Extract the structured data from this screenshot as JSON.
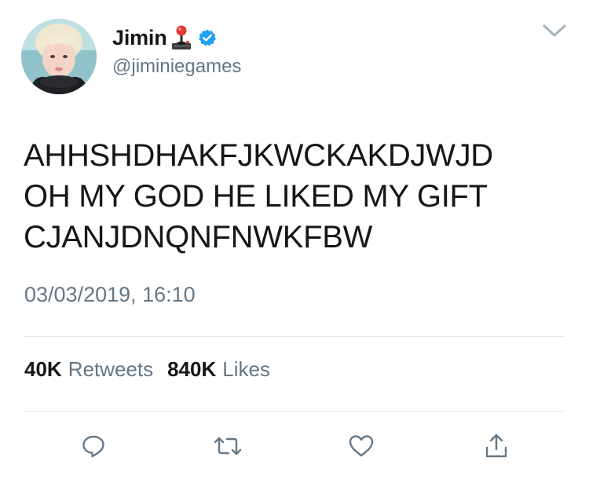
{
  "user": {
    "display_name": "Jimin",
    "handle": "@jiminiegames",
    "name_emoji": "joystick-icon",
    "verified": true
  },
  "tweet": {
    "lines": [
      "AHHSHDHAKFJKWCKAKDJWJD",
      "OH MY GOD HE LIKED MY GIFT",
      "CJANJDNQNFNWKFBW"
    ],
    "timestamp": "03/03/2019, 16:10"
  },
  "stats": {
    "retweets_count": "40K",
    "retweets_label": "Retweets",
    "likes_count": "840K",
    "likes_label": "Likes"
  },
  "actions": [
    "reply-icon",
    "retweet-icon",
    "like-icon",
    "share-icon"
  ],
  "colors": {
    "text": "#14171a",
    "secondary": "#657786",
    "verified_blue": "#1da1f2",
    "divider": "#e1e8ed",
    "icon_gray": "#657786"
  }
}
